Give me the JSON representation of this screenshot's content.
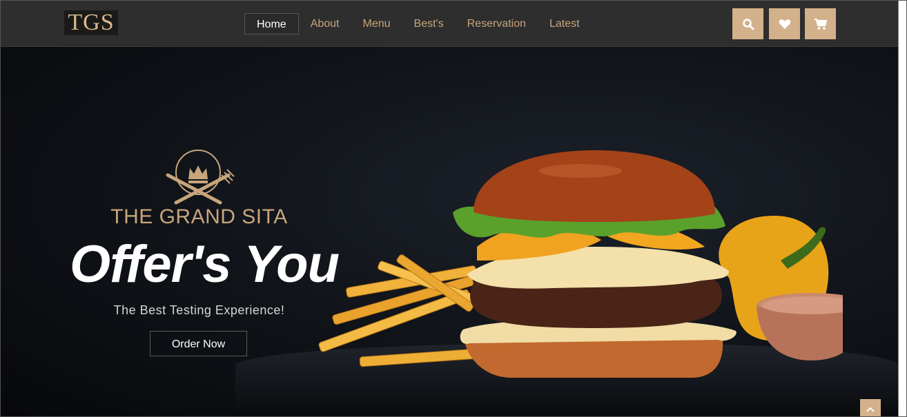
{
  "brand": {
    "logo_text": "TGS"
  },
  "nav": {
    "items": [
      {
        "label": "Home",
        "active": true
      },
      {
        "label": "About"
      },
      {
        "label": "Menu"
      },
      {
        "label": "Best's"
      },
      {
        "label": "Reservation"
      },
      {
        "label": "Latest"
      }
    ]
  },
  "actions": {
    "icons": [
      "search-icon",
      "heart-icon",
      "cart-icon"
    ]
  },
  "hero": {
    "brand_name": "THE GRAND SITA",
    "headline": "Offer's You",
    "tagline": "The Best Testing Experience!",
    "cta_label": "Order Now"
  },
  "colors": {
    "accent": "#d3b18a",
    "nav_text": "#c8a57c",
    "nav_bg": "#2e2e2e"
  }
}
